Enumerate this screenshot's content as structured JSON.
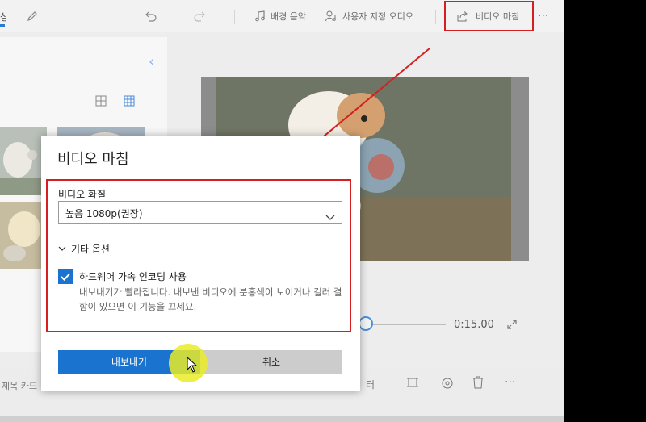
{
  "toolbar": {
    "partial_left_text": "상",
    "music_label": "배경 음악",
    "custom_audio_label": "사용자 지정 오디오",
    "finish_video_label": "비디오 마침",
    "more_label": "···"
  },
  "player": {
    "duration": "0:15.00"
  },
  "bottom": {
    "partial_title": "제목 카드",
    "partial_right": "터",
    "more_label": "···"
  },
  "dialog": {
    "title": "비디오 마침",
    "quality_label": "비디오 화질",
    "quality_value": "높음 1080p(권장)",
    "more_options_label": "기타 옵션",
    "hw_accel_label": "하드웨어 가속 인코딩 사용",
    "hw_accel_desc": "내보내기가 빨라집니다. 내보낸 비디오에 분홍색이 보이거나 컬러 결함이 있으면 이 기능을 끄세요.",
    "hw_accel_checked": true,
    "export_button": "내보내기",
    "cancel_button": "취소"
  },
  "colors": {
    "accent": "#1a73cf",
    "annotation": "#d42020"
  }
}
